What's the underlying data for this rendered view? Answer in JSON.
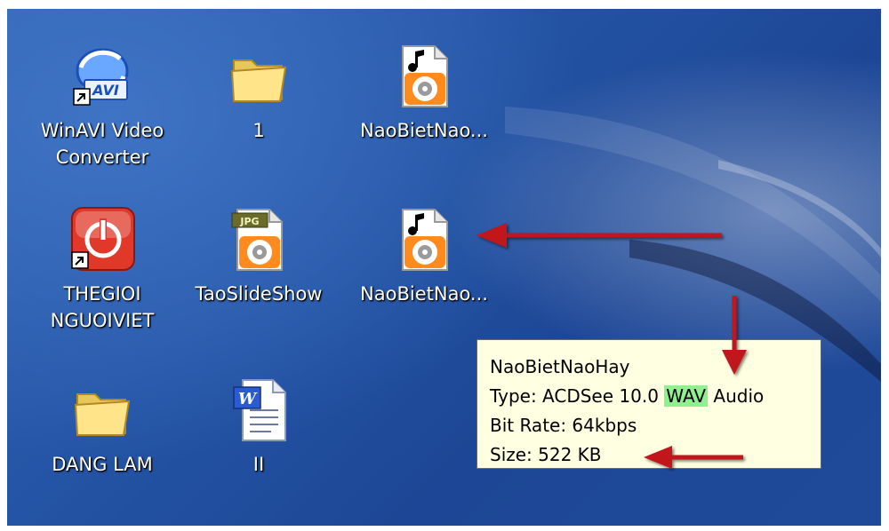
{
  "desktop": {
    "icons": [
      {
        "name": "WinAVI Video Converter",
        "label": "WinAVI Video\nConverter",
        "icon": "winavi-shortcut-icon"
      },
      {
        "name": "1",
        "label": "1",
        "icon": "folder-icon"
      },
      {
        "name": "NaoBietNao...",
        "label": "NaoBietNao...",
        "icon": "audio-file-icon"
      },
      {
        "name": "THEGIOI NGUOIVIET",
        "label": "THEGIOI\nNGUOIVIET",
        "icon": "power-shortcut-icon"
      },
      {
        "name": "TaoSlideShow",
        "label": "TaoSlideShow",
        "icon": "jpg-file-icon"
      },
      {
        "name": "NaoBietNao...",
        "label": "NaoBietNao...",
        "icon": "audio-file-icon"
      },
      {
        "name": "DANG LAM",
        "label": "DANG LAM",
        "icon": "folder-icon"
      },
      {
        "name": "II",
        "label": "II",
        "icon": "word-document-icon"
      }
    ]
  },
  "tooltip": {
    "filename": "NaoBietNaoHay",
    "type_prefix": "Type: ACDSee 10.0 ",
    "type_highlight": "WAV",
    "type_suffix": " Audio",
    "bitrate": "Bit Rate: 64kbps",
    "size": "Size: 522 KB"
  },
  "colors": {
    "desktop_blue": "#2555a6",
    "tooltip_bg": "#ffffe1",
    "highlight": "#8ef08e",
    "arrow": "#c0141a"
  }
}
